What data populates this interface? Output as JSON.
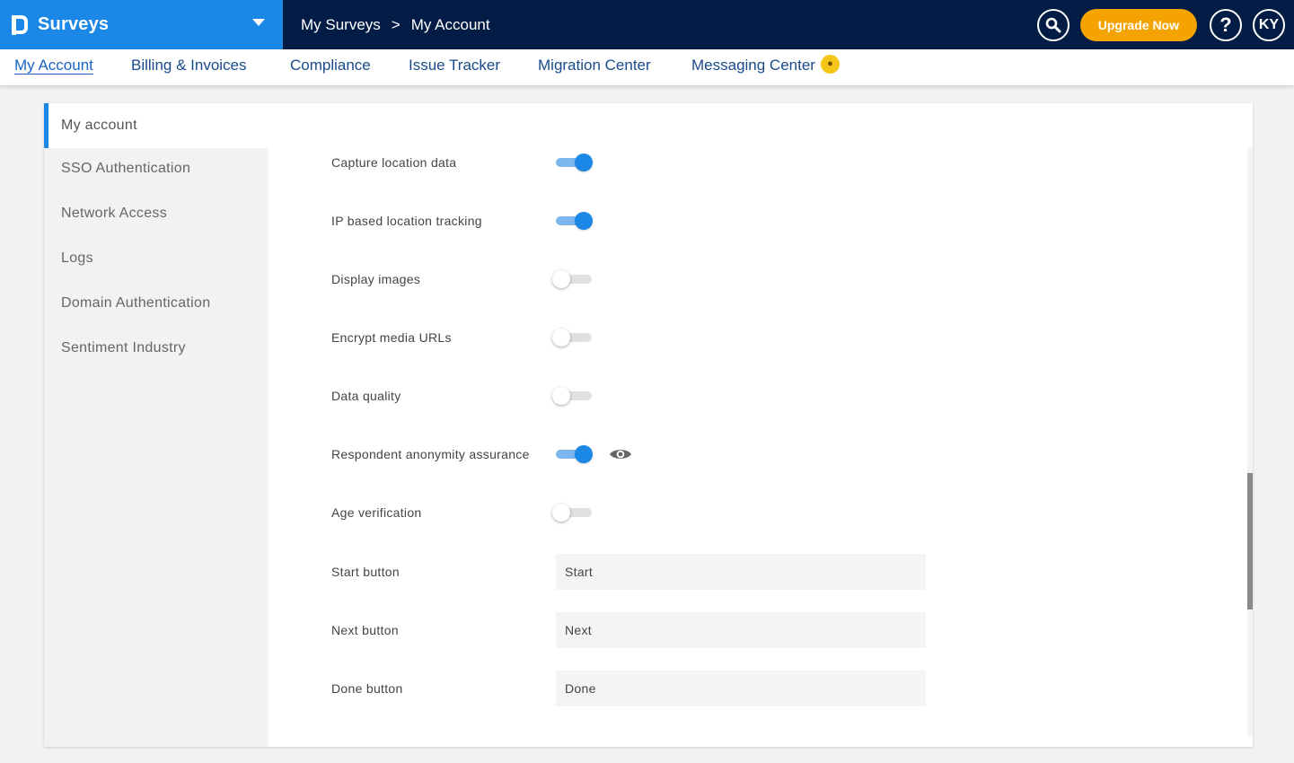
{
  "app": {
    "brand_name": "Surveys"
  },
  "breadcrumb": {
    "items": [
      "My Surveys",
      "My Account"
    ],
    "separator": ">"
  },
  "top_actions": {
    "upgrade_label": "Upgrade Now",
    "help_label": "?",
    "avatar_initials": "KY"
  },
  "subnav": {
    "items": [
      {
        "label": "My Account",
        "active": true
      },
      {
        "label": "Billing & Invoices",
        "active": false
      },
      {
        "label": "Compliance",
        "active": false
      },
      {
        "label": "Issue Tracker",
        "active": false
      },
      {
        "label": "Migration Center",
        "active": false
      },
      {
        "label": "Messaging Center",
        "active": false
      }
    ]
  },
  "sidebar": {
    "items": [
      {
        "label": "My account",
        "active": true
      },
      {
        "label": "SSO Authentication",
        "active": false
      },
      {
        "label": "Network Access",
        "active": false
      },
      {
        "label": "Logs",
        "active": false
      },
      {
        "label": "Domain Authentication",
        "active": false
      },
      {
        "label": "Sentiment Industry",
        "active": false
      }
    ]
  },
  "settings": {
    "toggles": [
      {
        "label": "Capture location data",
        "on": true
      },
      {
        "label": "IP based location tracking",
        "on": true
      },
      {
        "label": "Display images",
        "on": false
      },
      {
        "label": "Encrypt media URLs",
        "on": false
      },
      {
        "label": "Data quality",
        "on": false
      },
      {
        "label": "Respondent anonymity assurance",
        "on": true,
        "has_preview_icon": true
      },
      {
        "label": "Age verification",
        "on": false
      }
    ],
    "text_fields": [
      {
        "label": "Start button",
        "value": "Start"
      },
      {
        "label": "Next button",
        "value": "Next"
      },
      {
        "label": "Done button",
        "value": "Done"
      }
    ]
  },
  "colors": {
    "brand_blue": "#1b87e6",
    "navy": "#031c46",
    "upgrade_orange": "#f5a300",
    "toggle_track_on": "#7cb6ee"
  },
  "icons": {
    "search": "search-icon",
    "help": "help-icon",
    "preview": "eye-icon",
    "brand_menu": "chevron-down-icon",
    "messaging_badge": "medal-icon"
  }
}
